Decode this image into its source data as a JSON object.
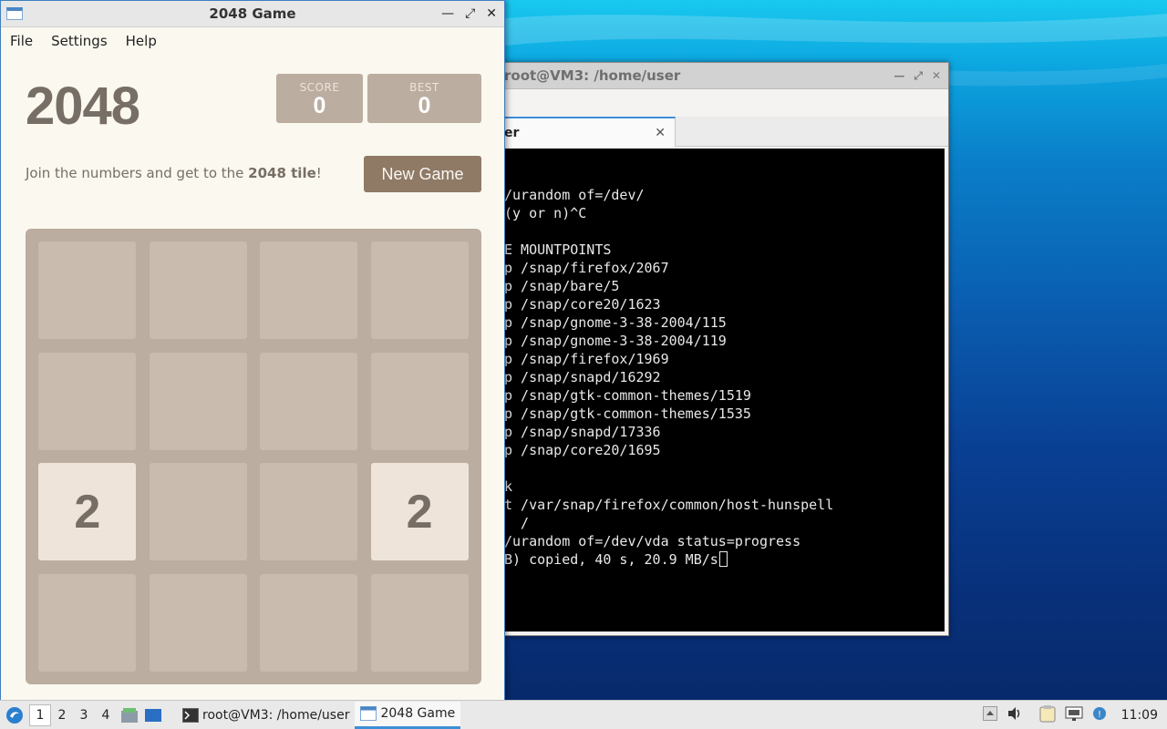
{
  "desktop": {},
  "terminal_window": {
    "title": "root@VM3: /home/user",
    "tab_label": "er",
    "lines": [
      "",
      "/urandom of=/dev/",
      "(y or n)^C",
      "",
      "E MOUNTPOINTS",
      "p /snap/firefox/2067",
      "p /snap/bare/5",
      "p /snap/core20/1623",
      "p /snap/gnome-3-38-2004/115",
      "p /snap/gnome-3-38-2004/119",
      "p /snap/firefox/1969",
      "p /snap/snapd/16292",
      "p /snap/gtk-common-themes/1519",
      "p /snap/gtk-common-themes/1535",
      "p /snap/snapd/17336",
      "p /snap/core20/1695",
      "",
      "k",
      "t /var/snap/firefox/common/host-hunspell",
      "  /",
      "/urandom of=/dev/vda status=progress",
      "B) copied, 40 s, 20.9 MB/s"
    ]
  },
  "game_window": {
    "title": "2048 Game",
    "menu": [
      "File",
      "Settings",
      "Help"
    ],
    "heading": "2048",
    "score_label": "SCORE",
    "score_value": "0",
    "best_label": "BEST",
    "best_value": "0",
    "intro_prefix": "Join the numbers and get to the ",
    "intro_bold": "2048 tile",
    "intro_suffix": "!",
    "new_game_label": "New Game",
    "board": [
      [
        "",
        "",
        "",
        ""
      ],
      [
        "",
        "",
        "",
        ""
      ],
      [
        "2",
        "",
        "",
        "2"
      ],
      [
        "",
        "",
        "",
        ""
      ]
    ]
  },
  "taskbar": {
    "workspaces": [
      "1",
      "2",
      "3",
      "4"
    ],
    "active_workspace": "1",
    "tasks": [
      {
        "label": "root@VM3: /home/user",
        "icon": "terminal-icon"
      },
      {
        "label": "2048 Game",
        "icon": "window-icon"
      }
    ],
    "clock": "11:09"
  }
}
